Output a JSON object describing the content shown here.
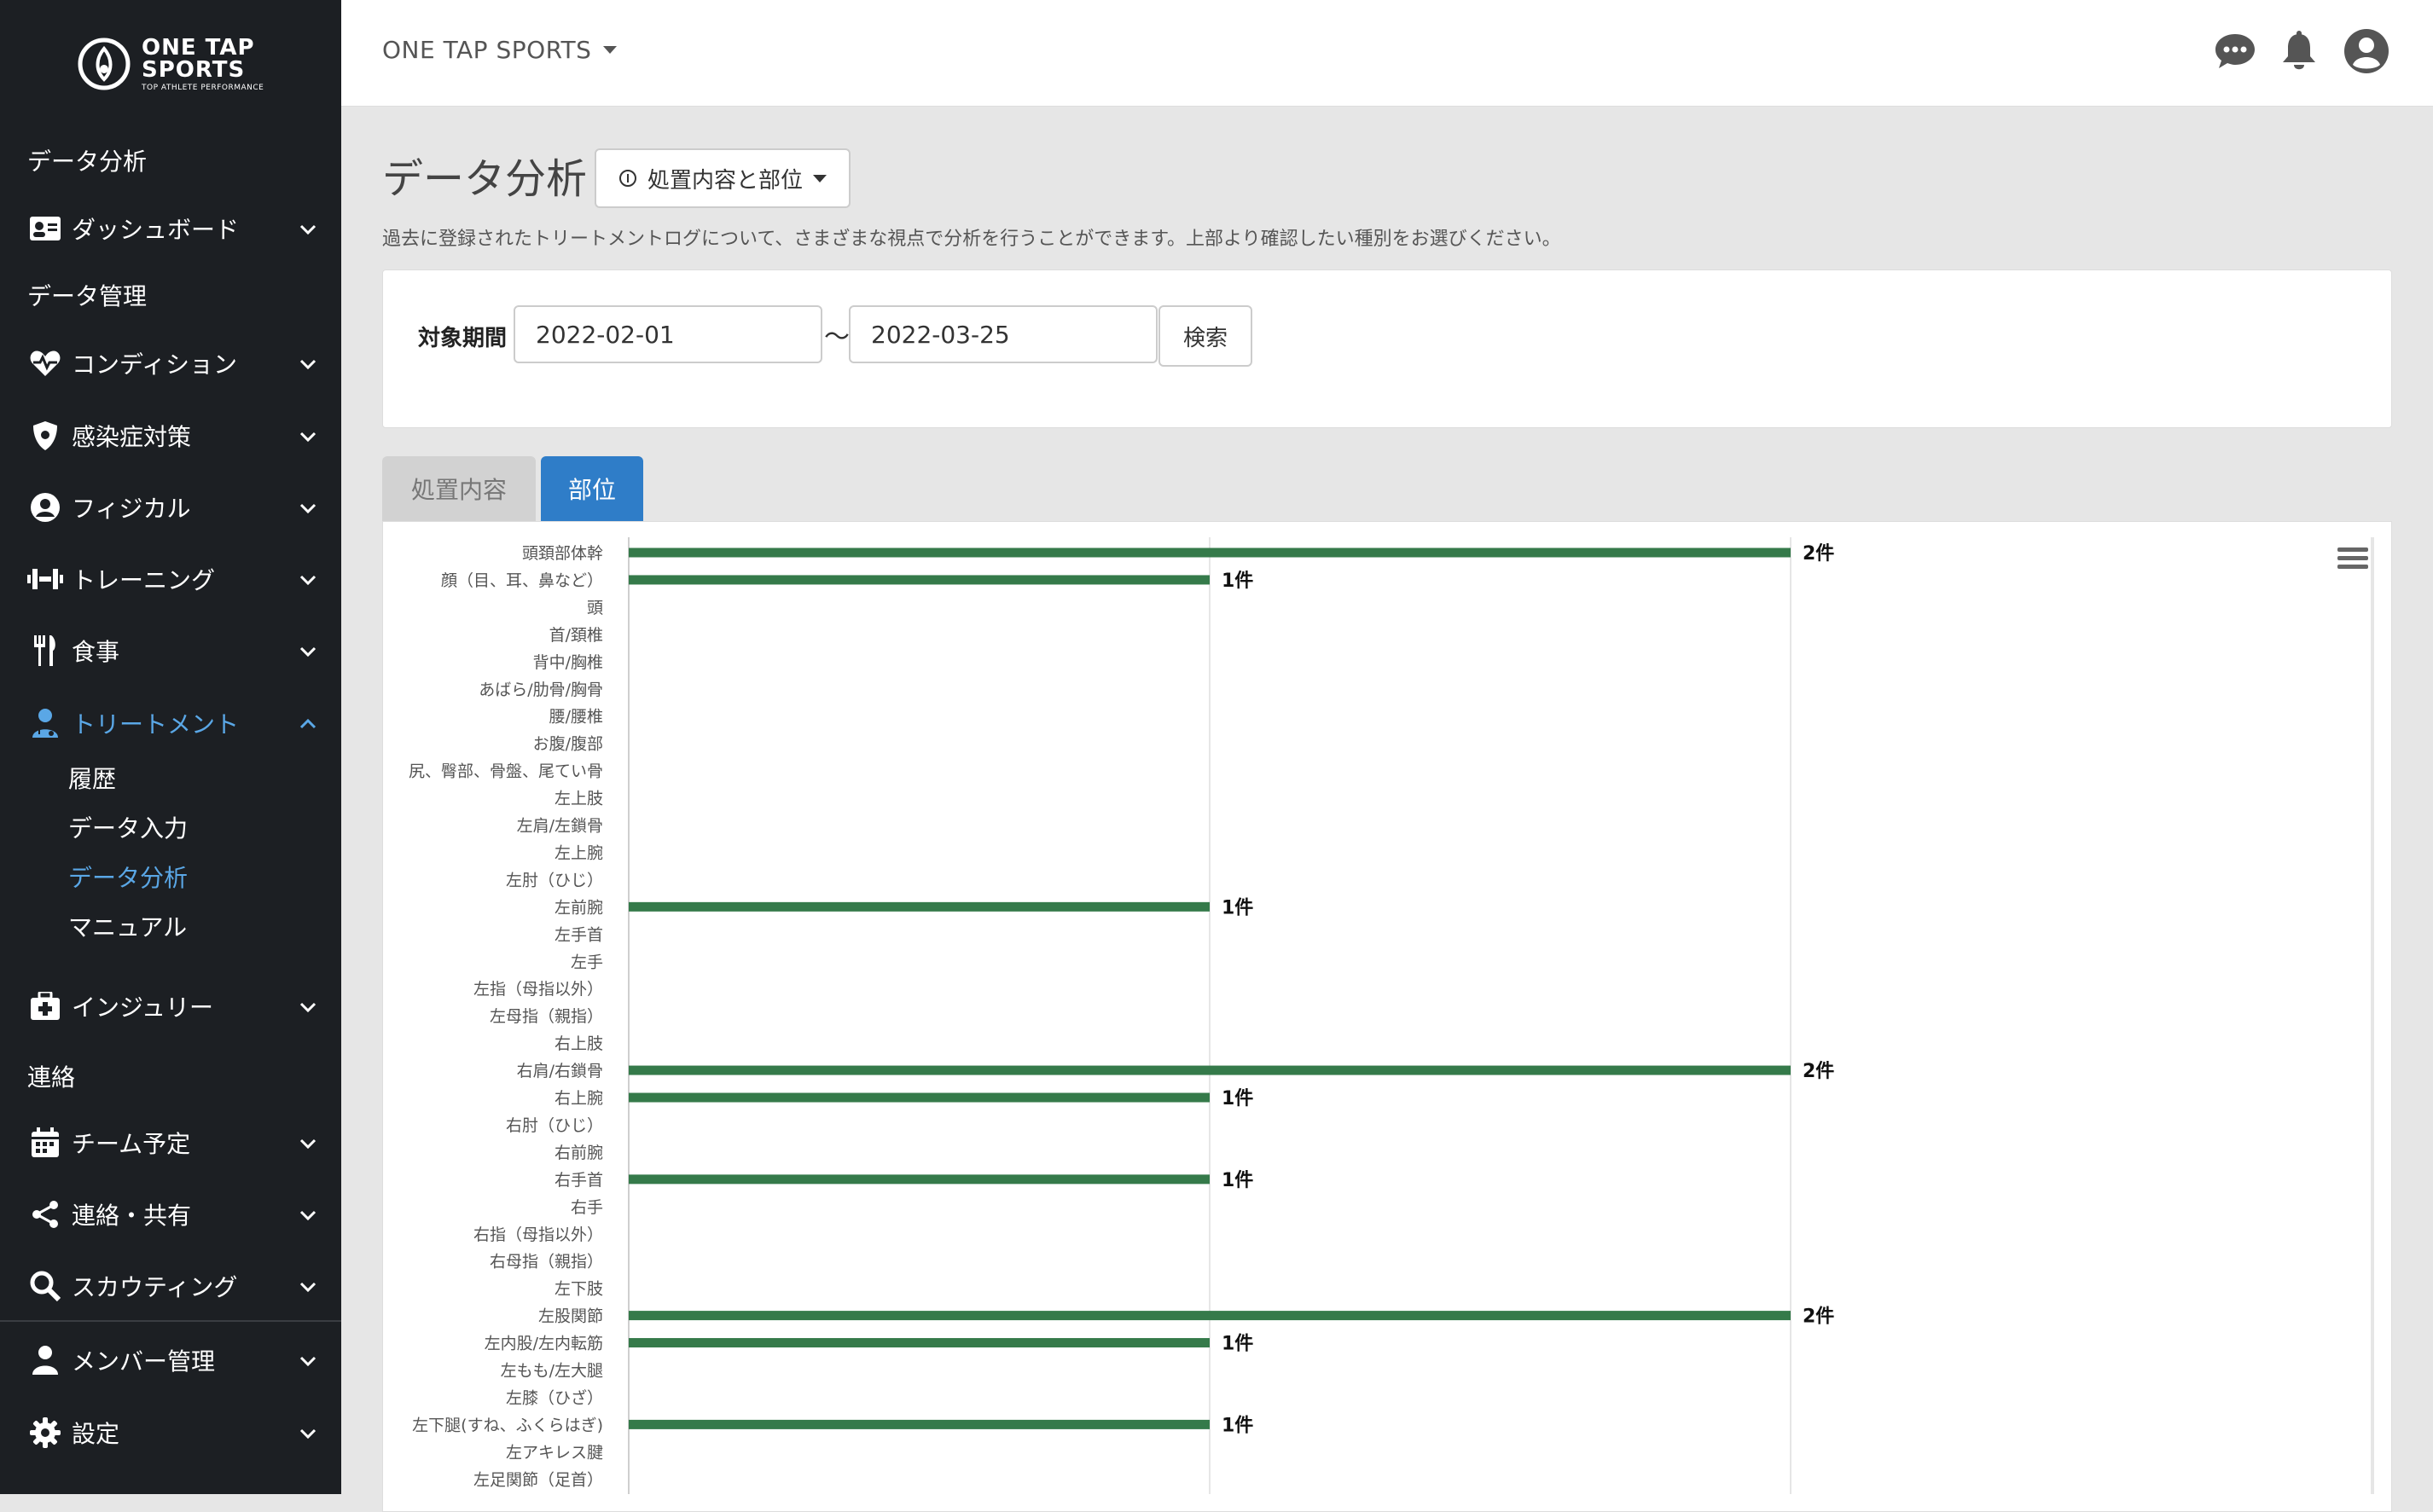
{
  "sidebar": {
    "logo": {
      "line1": "ONE TAP",
      "line2": "SPORTS",
      "tagline": "TOP ATHLETE PERFORMANCE"
    },
    "sections": {
      "analysis": "データ分析",
      "data_mgmt": "データ管理",
      "contact": "連絡"
    },
    "items": {
      "dashboard": {
        "label": "ダッシュボード",
        "icon": "id-card-icon"
      },
      "condition": {
        "label": "コンディション",
        "icon": "heartbeat-icon"
      },
      "infection": {
        "label": "感染症対策",
        "icon": "shield-icon"
      },
      "physical": {
        "label": "フィジカル",
        "icon": "user-circle-icon"
      },
      "training": {
        "label": "トレーニング",
        "icon": "dumbbell-icon"
      },
      "meal": {
        "label": "食事",
        "icon": "utensils-icon"
      },
      "treatment": {
        "label": "トリートメント",
        "icon": "doctor-icon"
      },
      "injury": {
        "label": "インジュリー",
        "icon": "medkit-icon"
      },
      "schedule": {
        "label": "チーム予定",
        "icon": "calendar-icon"
      },
      "share": {
        "label": "連絡・共有",
        "icon": "share-icon"
      },
      "scouting": {
        "label": "スカウティング",
        "icon": "search-icon"
      },
      "members": {
        "label": "メンバー管理",
        "icon": "user-icon"
      },
      "settings": {
        "label": "設定",
        "icon": "gear-icon"
      }
    },
    "treatment_sub": {
      "history": "履歴",
      "input": "データ入力",
      "analysis": "データ分析",
      "manual": "マニュアル"
    }
  },
  "topbar": {
    "brand": "ONE TAP SPORTS",
    "icons": [
      "chat-icon",
      "bell-icon",
      "avatar-icon"
    ]
  },
  "page": {
    "title": "データ分析",
    "mode_button": "処置内容と部位",
    "description": "過去に登録されたトリートメントログについて、さまざまな視点で分析を行うことができます。上部より確認したい種別をお選びください。"
  },
  "filter": {
    "label": "対象期間",
    "start": "2022-02-01",
    "separator": "〜",
    "end": "2022-03-25",
    "search_button": "検索"
  },
  "tabs": {
    "treatment": "処置内容",
    "part": "部位",
    "active": "part"
  },
  "colors": {
    "bar": "#357a4a",
    "accent": "#2f7dc8",
    "sidebar_bg": "#1c1f23",
    "sidebar_active": "#5aa7e6"
  },
  "chart_data": {
    "type": "bar",
    "orientation": "horizontal",
    "unit_suffix": "件",
    "xlim": [
      0,
      3
    ],
    "grid": true,
    "categories": [
      "頭頚部体幹",
      "顔（目、耳、鼻など）",
      "頭",
      "首/頚椎",
      "背中/胸椎",
      "あばら/肋骨/胸骨",
      "腰/腰椎",
      "お腹/腹部",
      "尻、臀部、骨盤、尾てい骨",
      "左上肢",
      "左肩/左鎖骨",
      "左上腕",
      "左肘（ひじ）",
      "左前腕",
      "左手首",
      "左手",
      "左指（母指以外）",
      "左母指（親指）",
      "右上肢",
      "右肩/右鎖骨",
      "右上腕",
      "右肘（ひじ）",
      "右前腕",
      "右手首",
      "右手",
      "右指（母指以外）",
      "右母指（親指）",
      "左下肢",
      "左股関節",
      "左内股/左内転筋",
      "左もも/左大腿",
      "左膝（ひざ）",
      "左下腿(すね、ふくらはぎ)",
      "左アキレス腱",
      "左足関節（足首）"
    ],
    "values": [
      2,
      1,
      0,
      0,
      0,
      0,
      0,
      0,
      0,
      0,
      0,
      0,
      0,
      1,
      0,
      0,
      0,
      0,
      0,
      2,
      1,
      0,
      0,
      1,
      0,
      0,
      0,
      0,
      2,
      1,
      0,
      0,
      1,
      0,
      0
    ],
    "data_labels": [
      "2件",
      "1件",
      "",
      "",
      "",
      "",
      "",
      "",
      "",
      "",
      "",
      "",
      "",
      "1件",
      "",
      "",
      "",
      "",
      "",
      "2件",
      "1件",
      "",
      "",
      "1件",
      "",
      "",
      "",
      "",
      "2件",
      "1件",
      "",
      "",
      "1件",
      "",
      ""
    ]
  }
}
